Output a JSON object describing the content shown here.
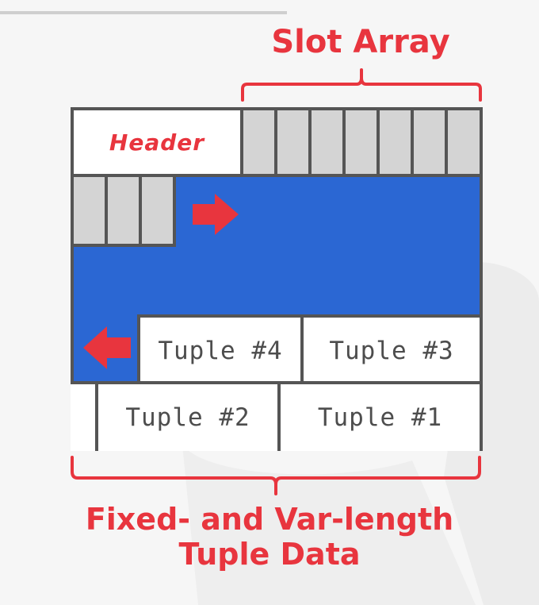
{
  "labels": {
    "slot_array": "Slot Array",
    "data_line1": "Fixed- and Var-length",
    "data_line2": "Tuple Data"
  },
  "page": {
    "header": "Header",
    "tuples": {
      "t4": "Tuple #4",
      "t3": "Tuple #3",
      "t2": "Tuple #2",
      "t1": "Tuple #1"
    }
  },
  "colors": {
    "accent_red": "#e8353e",
    "free_space_blue": "#2b67d3",
    "slot_gray": "#d4d4d4",
    "border": "#555555"
  }
}
